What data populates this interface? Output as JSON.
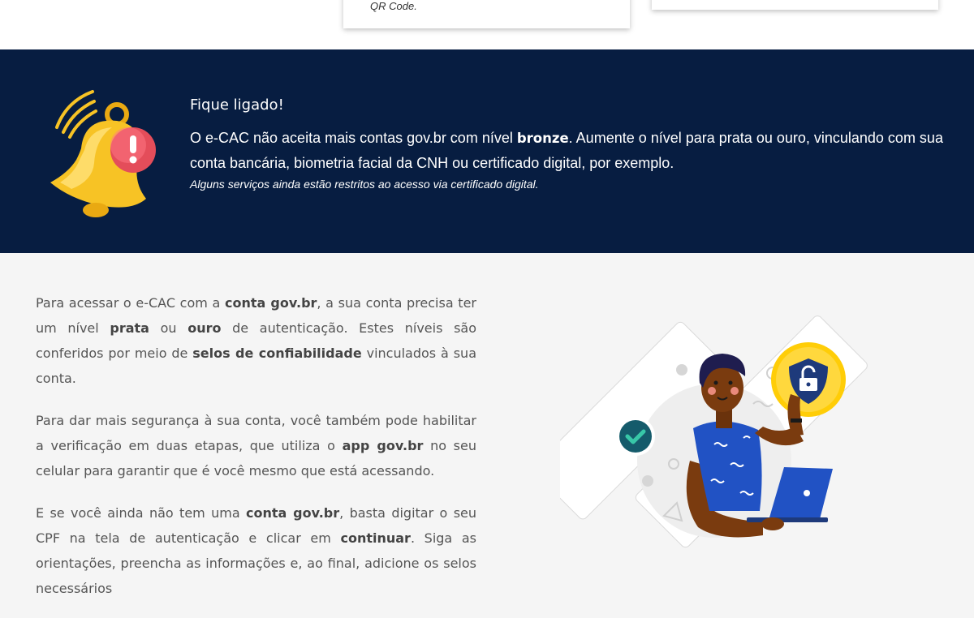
{
  "top_cards": {
    "mid_text": "QR Code."
  },
  "banner": {
    "title": "Fique ligado!",
    "text_part1": "O e-CAC não aceita mais contas gov.br com nível ",
    "text_bold": "bronze",
    "text_part2": ". Aumente o nível para prata ou ouro, vinculando com sua conta bancária, biometria facial da CNH ou certificado digital, por exemplo.",
    "note": "Alguns serviços ainda estão restritos ao acesso via certificado digital."
  },
  "content": {
    "p1": {
      "a": "Para acessar o e-CAC com a ",
      "b": "conta gov.br",
      "c": ", a sua conta precisa ter um nível ",
      "d": "prata",
      "e": " ou ",
      "f": "ouro",
      "g": " de autenticação. Estes níveis são conferidos por meio de ",
      "h": "selos de confiabilidade",
      "i": " vinculados à sua conta."
    },
    "p2": {
      "a": "Para dar mais segurança à sua conta, você também pode habilitar a verificação em duas etapas, que utiliza o ",
      "b": "app gov.br",
      "c": " no seu celular para garantir que é você mesmo que está acessando."
    },
    "p3": {
      "a": "E se você ainda não tem uma ",
      "b": "conta gov.br",
      "c": ", basta digitar o seu CPF na tela de autenticação e clicar em ",
      "d": "continuar",
      "e": ". Siga as orientações, preencha as informações e, ao final, adicione os selos necessários"
    }
  },
  "icons": {
    "bell": "bell-alert-icon",
    "check": "check-icon",
    "lock": "unlocked-shield-icon"
  },
  "colors": {
    "banner_bg": "#071d41",
    "bell_yellow": "#f7c325",
    "alert_red": "#e44d5a",
    "shirt_blue": "#2152c4",
    "badge_yellow": "#ffcd07",
    "shield_navy": "#1e3a7b"
  }
}
